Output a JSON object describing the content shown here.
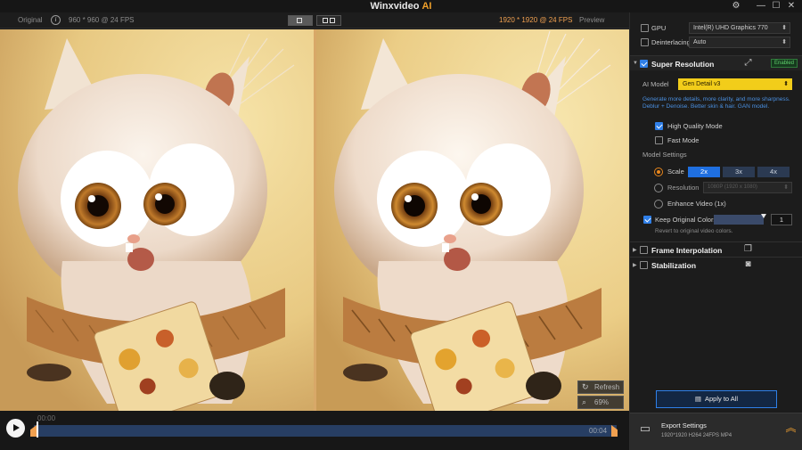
{
  "titlebar": {
    "app_name": "Winxvideo",
    "app_suffix": "AI"
  },
  "preview": {
    "left_label": "Original",
    "left_meta": "960 * 960 @ 24 FPS",
    "right_meta": "1920 * 1920 @ 24 FPS",
    "right_label": "Preview",
    "refresh_label": "Refresh",
    "zoom_value": "69%"
  },
  "timeline": {
    "start_time": "00:00",
    "end_time": "00:04",
    "progress": 0.005
  },
  "panel": {
    "gpu_label": "GPU",
    "gpu_value": "Intel(R) UHD Graphics 770",
    "deinterlacing_label": "Deinterlacing",
    "deinterlacing_value": "Auto",
    "super_resolution": {
      "title": "Super Resolution",
      "badge": "Enabled",
      "ai_model_label": "AI Model",
      "ai_model_value": "Gen Detail v3",
      "description": "Generate more details, more clarity, and more sharpness. Deblur + Denoise. Better skin & hair. GAN model.",
      "high_quality": "High Quality Mode",
      "fast_mode": "Fast Mode",
      "model_settings": "Model Settings",
      "scale_label": "Scale",
      "scale_options": [
        "2x",
        "3x",
        "4x"
      ],
      "resolution_label": "Resolution",
      "resolution_value": "1080P (1920 x 1080)",
      "enhance_label": "Enhance Video (1x)",
      "keep_colors_label": "Keep Original Colors",
      "keep_colors_value": "1",
      "keep_colors_note": "Revert to original video colors."
    },
    "frame_interpolation": "Frame Interpolation",
    "stabilization": "Stabilization",
    "apply_all": "Apply to All",
    "export_title": "Export Settings",
    "export_meta": "1920*1920   H264   24FPS   MP4"
  }
}
